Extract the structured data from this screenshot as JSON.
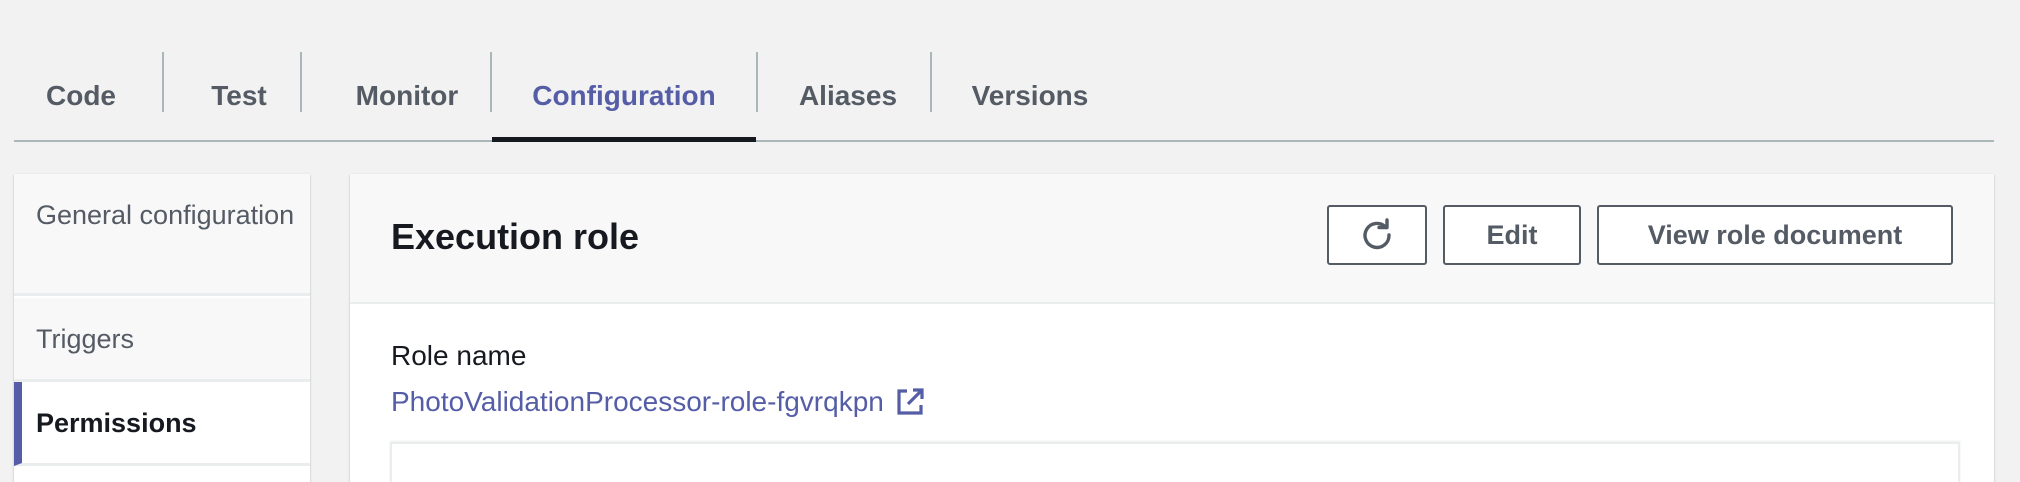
{
  "tabs": [
    {
      "label": "Code"
    },
    {
      "label": "Test"
    },
    {
      "label": "Monitor"
    },
    {
      "label": "Configuration"
    },
    {
      "label": "Aliases"
    },
    {
      "label": "Versions"
    }
  ],
  "active_tab": "Configuration",
  "sidebar": {
    "items": [
      {
        "label": "General configuration"
      },
      {
        "label": "Triggers"
      },
      {
        "label": "Permissions"
      }
    ],
    "active_item": "Permissions"
  },
  "panel": {
    "title": "Execution role",
    "refresh_icon": "refresh-icon",
    "edit_label": "Edit",
    "view_role_label": "View role document",
    "role_name_label": "Role name",
    "role_name_value": "PhotoValidationProcessor-role-fgvrqkpn",
    "external_link_icon": "external-link-icon"
  },
  "colors": {
    "accent": "#545da6",
    "text_dark": "#16191f",
    "text_muted": "#545b64",
    "background": "#f1f2f1",
    "divider": "#aab7b8"
  }
}
